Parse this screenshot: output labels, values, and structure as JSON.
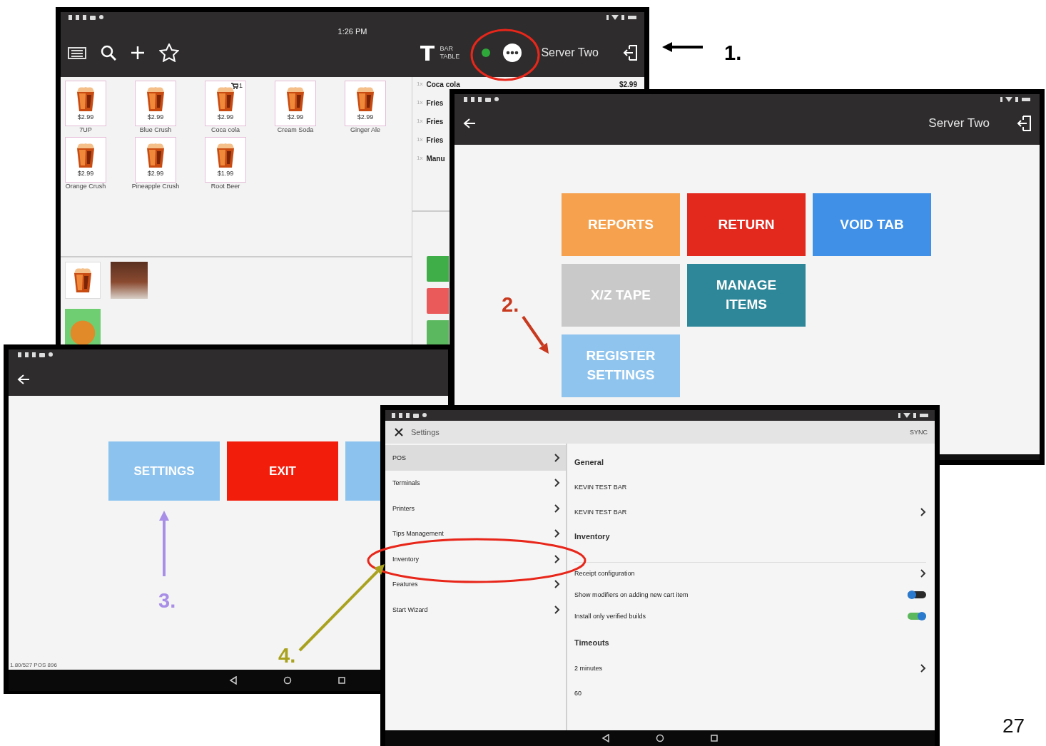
{
  "pos_screen": {
    "time": "1:26 PM",
    "table_button": "BAR TABLE",
    "server": "Server Two",
    "products": [
      {
        "price": "$2.99",
        "name": "7UP"
      },
      {
        "price": "$2.99",
        "name": "Blue Crush"
      },
      {
        "price": "$2.99",
        "name": "Coca cola",
        "cart_count": "1"
      },
      {
        "price": "$2.99",
        "name": "Cream Soda"
      },
      {
        "price": "$2.99",
        "name": "Ginger Ale"
      },
      {
        "price": "$2.99",
        "name": "Orange Crush"
      },
      {
        "price": "$2.99",
        "name": "Pineapple Crush"
      },
      {
        "price": "$1.99",
        "name": "Root Beer"
      }
    ],
    "order_lines": [
      {
        "qty": "1x",
        "name": "Coca cola",
        "price": "$2.99"
      },
      {
        "qty": "1x",
        "name": "Fries"
      },
      {
        "qty": "1x",
        "name": "Fries"
      },
      {
        "qty": "1x",
        "name": "Fries"
      },
      {
        "qty": "1x",
        "name": "Manu"
      }
    ],
    "categories": [
      {
        "kind": "drink"
      },
      {
        "kind": "photo"
      },
      {
        "kind": "photo"
      }
    ]
  },
  "menu_screen": {
    "server": "Server Two",
    "tile_rows": [
      [
        {
          "label": "REPORTS",
          "color": "#f6a14e"
        },
        {
          "label": "RETURN",
          "color": "#e3281d"
        },
        {
          "label": "VOID TAB",
          "color": "#3f90e6"
        }
      ],
      [
        {
          "label": "X/Z TAPE",
          "color": "#c9c9c9"
        },
        {
          "label": "MANAGE ITEMS",
          "color": "#2e8699"
        }
      ],
      [
        {
          "label": "REGISTER SETTINGS",
          "color": "#8fc4ee"
        }
      ]
    ]
  },
  "options_screen": {
    "buttons": [
      {
        "label": "SETTINGS",
        "color": "#8cc2ee"
      },
      {
        "label": "EXIT",
        "color": "#f31d0c"
      },
      {
        "color": "#8cc2ee"
      }
    ],
    "version": "1.80/527 POS 896"
  },
  "settings_screen": {
    "title": "Settings",
    "sync": "SYNC",
    "menu": [
      {
        "label": "POS",
        "selected": true
      },
      {
        "label": "Terminals",
        "selected": false
      },
      {
        "label": "Printers",
        "selected": false
      },
      {
        "label": "Tips Management",
        "selected": false
      },
      {
        "label": "Inventory",
        "selected": false
      },
      {
        "label": "Features",
        "selected": false
      },
      {
        "label": "Start Wizard",
        "selected": false
      }
    ],
    "rows": [
      {
        "kind": "heading",
        "text": "General"
      },
      {
        "kind": "captioned",
        "text": "KEVIN TEST BAR"
      },
      {
        "kind": "captioned_link",
        "text": "KEVIN TEST BAR"
      },
      {
        "kind": "heading",
        "text": "Inventory"
      },
      {
        "kind": "link",
        "text": "Receipt configuration"
      },
      {
        "kind": "toggle",
        "text": "Show modifiers on adding new cart item",
        "on": false
      },
      {
        "kind": "toggle",
        "text": "Install only verified builds",
        "on": true
      },
      {
        "kind": "heading",
        "text": "Timeouts"
      },
      {
        "kind": "captioned_link",
        "text": "2 minutes"
      },
      {
        "kind": "captioned",
        "text": "60"
      }
    ]
  },
  "annotations": [
    {
      "label": "1.",
      "color": "#000000"
    },
    {
      "label": "2.",
      "color": "#c8391e"
    },
    {
      "label": "3.",
      "color": "#a88ee6"
    },
    {
      "label": "4.",
      "color": "#a9a21e"
    }
  ],
  "page_number": "27"
}
